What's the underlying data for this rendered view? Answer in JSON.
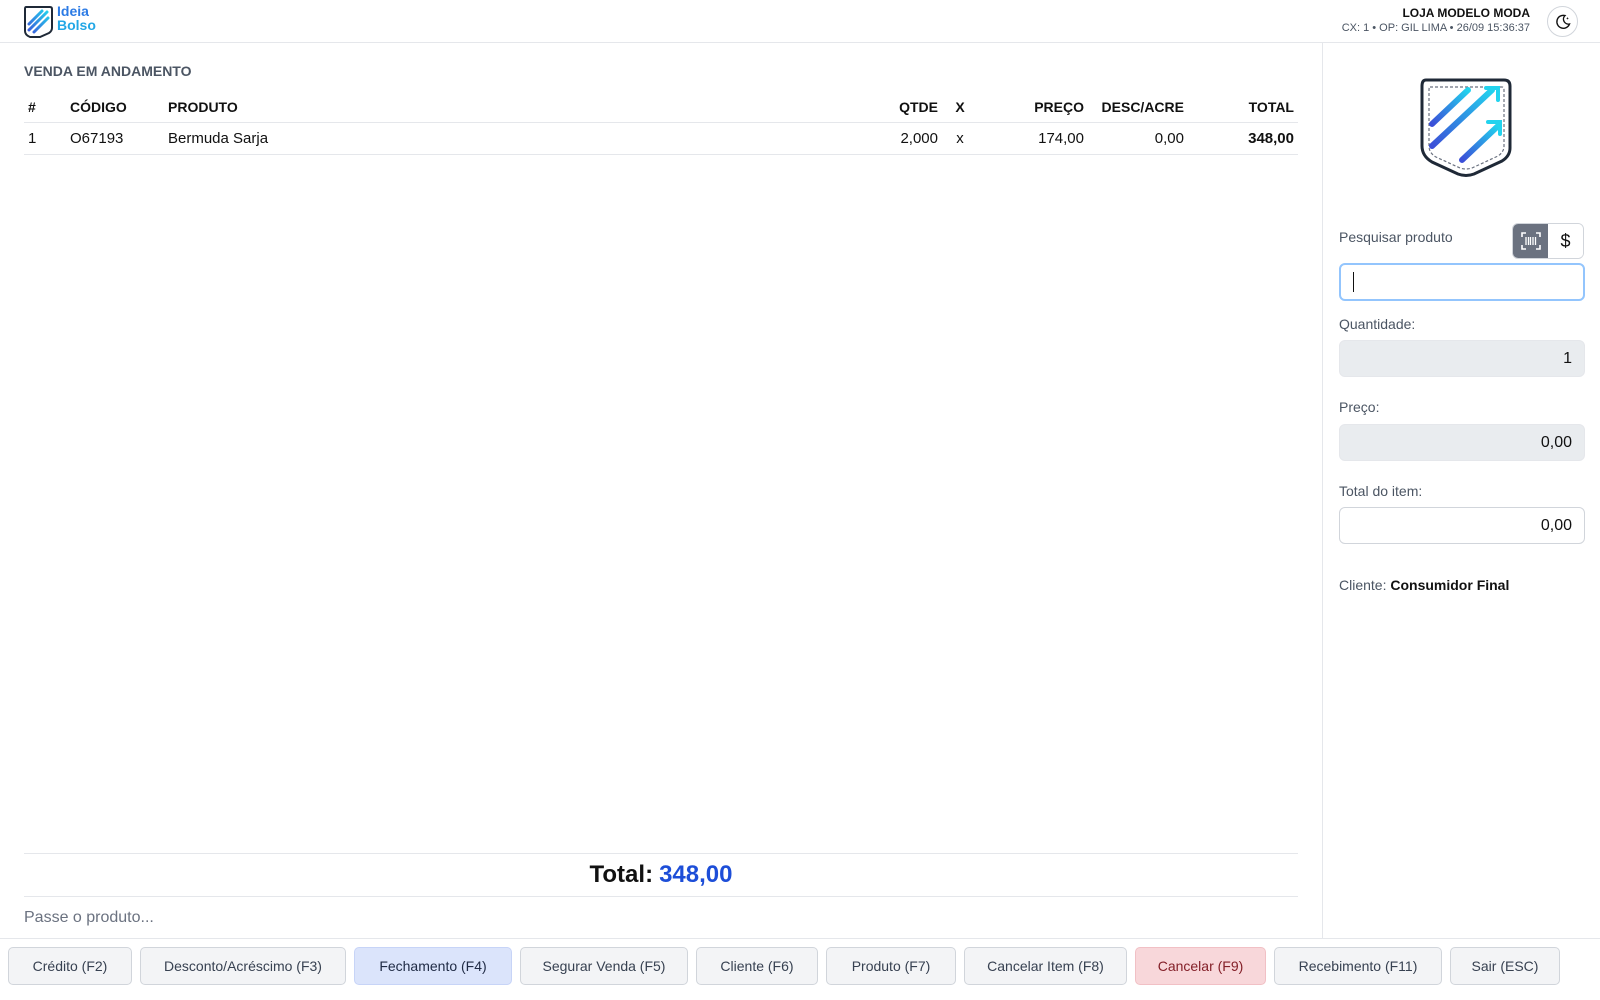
{
  "header": {
    "logo_line1": "Ideia",
    "logo_line2": "Bolso",
    "store_name": "LOJA MODELO MODA",
    "store_sub": "CX: 1 • OP: GIL LIMA • 26/09 15:36:37",
    "theme_icon": "moon-icon"
  },
  "sale": {
    "section_title": "VENDA EM ANDAMENTO",
    "columns": [
      "#",
      "CÓDIGO",
      "PRODUTO",
      "QTDE",
      "X",
      "PREÇO",
      "DESC/ACRE",
      "TOTAL"
    ],
    "rows": [
      {
        "num": "1",
        "code": "O67193",
        "product": "Bermuda Sarja",
        "qty": "2,000",
        "x": "x",
        "price": "174,00",
        "disc": "0,00",
        "total": "348,00"
      }
    ],
    "total_label": "Total:",
    "total_value": "348,00",
    "passe_hint": "Passe o produto..."
  },
  "side": {
    "search_label": "Pesquisar produto",
    "search_value": "",
    "barcode_icon": "barcode-icon",
    "price_toggle_symbol": "$",
    "quantity_label": "Quantidade:",
    "quantity_value": "1",
    "price_label": "Preço:",
    "price_value": "0,00",
    "item_total_label": "Total do item:",
    "item_total_value": "0,00",
    "client_label": "Cliente:",
    "client_value": "Consumidor Final"
  },
  "footer": {
    "buttons": [
      "Crédito (F2)",
      "Desconto/Acréscimo (F3)",
      "Fechamento (F4)",
      "Segurar Venda (F5)",
      "Cliente (F6)",
      "Produto (F7)",
      "Cancelar Item (F8)",
      "Cancelar (F9)",
      "Recebimento (F11)",
      "Sair (ESC)"
    ]
  },
  "colors": {
    "accent": "#1d4ed8",
    "primary_button": "#dbe4fb",
    "danger_button": "#f8d7da"
  }
}
